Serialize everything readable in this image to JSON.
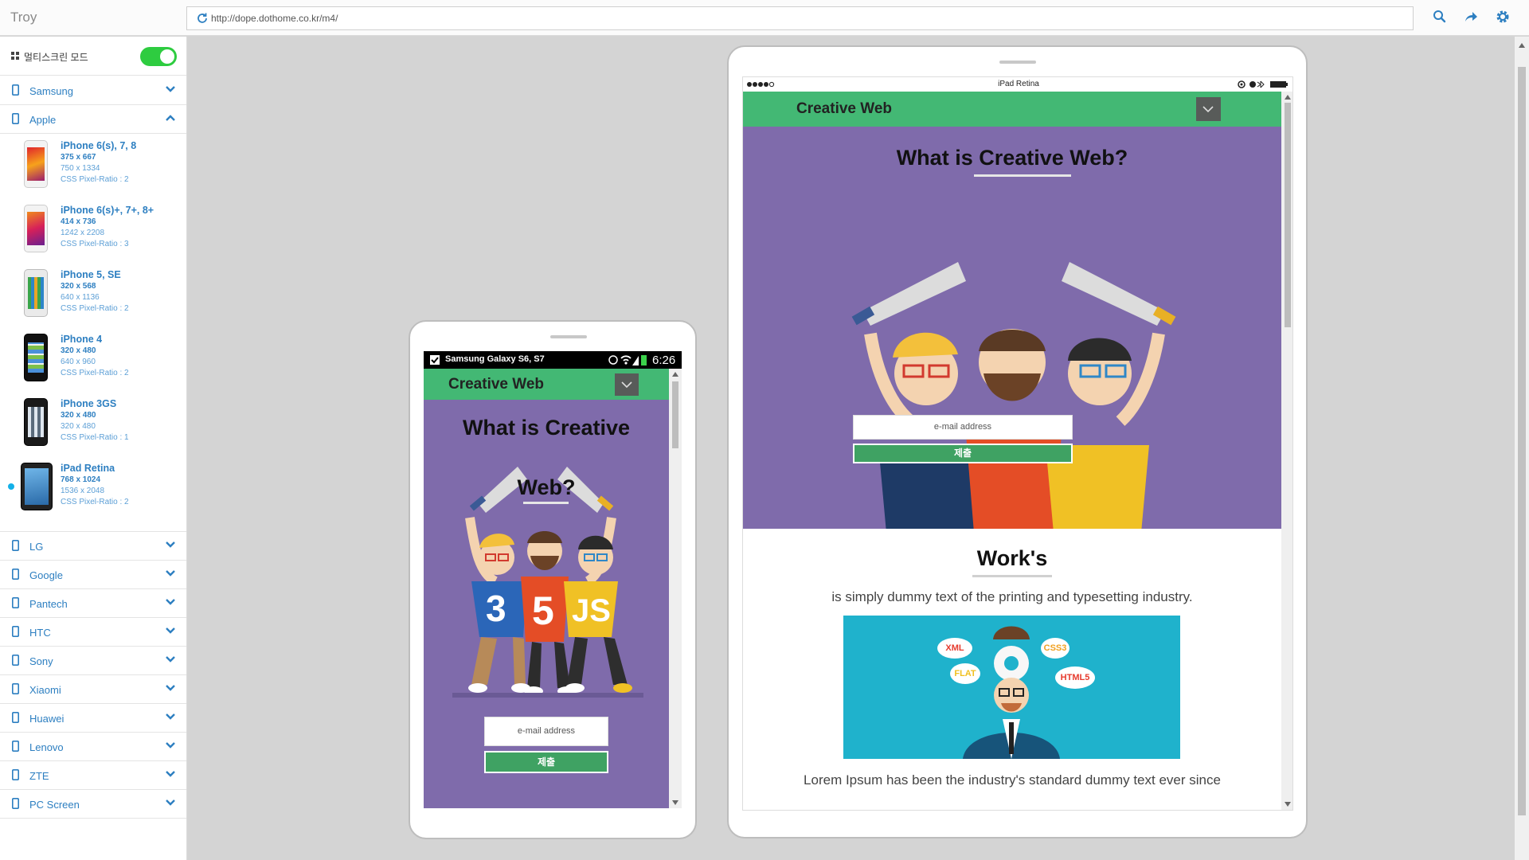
{
  "app": {
    "title": "Troy"
  },
  "address_bar": {
    "url": "http://dope.dothome.co.kr/m4/"
  },
  "sidebar": {
    "multiscreen_label": "멀티스크린 모드",
    "multiscreen_enabled": true,
    "brands_top": [
      {
        "label": "Samsung",
        "expanded": false
      },
      {
        "label": "Apple",
        "expanded": true
      }
    ],
    "apple_devices": [
      {
        "name": "iPhone 6(s), 7, 8",
        "resolution": "375 x 667",
        "physical": "750 x 1334",
        "ratio": "CSS Pixel-Ratio : 2"
      },
      {
        "name": "iPhone 6(s)+, 7+, 8+",
        "resolution": "414 x 736",
        "physical": "1242 x 2208",
        "ratio": "CSS Pixel-Ratio : 3"
      },
      {
        "name": "iPhone 5, SE",
        "resolution": "320 x 568",
        "physical": "640 x 1136",
        "ratio": "CSS Pixel-Ratio : 2"
      },
      {
        "name": "iPhone 4",
        "resolution": "320 x 480",
        "physical": "640 x 960",
        "ratio": "CSS Pixel-Ratio : 2"
      },
      {
        "name": "iPhone 3GS",
        "resolution": "320 x 480",
        "physical": "320 x 480",
        "ratio": "CSS Pixel-Ratio : 1"
      },
      {
        "name": "iPad Retina",
        "resolution": "768 x 1024",
        "physical": "1536 x 2048",
        "ratio": "CSS Pixel-Ratio : 2",
        "active": true
      }
    ],
    "brands_bottom": [
      {
        "label": "LG"
      },
      {
        "label": "Google"
      },
      {
        "label": "Pantech"
      },
      {
        "label": "HTC"
      },
      {
        "label": "Sony"
      },
      {
        "label": "Xiaomi"
      },
      {
        "label": "Huawei"
      },
      {
        "label": "Lenovo"
      },
      {
        "label": "ZTE"
      },
      {
        "label": "PC Screen"
      }
    ]
  },
  "phone": {
    "device_label": "Samsung Galaxy S6, S7",
    "time": "6:26",
    "site_title": "Creative Web",
    "headline_line1": "What is Creative",
    "headline_line2": "Web?",
    "email_placeholder": "e-mail address",
    "submit_label": "제출"
  },
  "ipad": {
    "device_label": "iPad Retina",
    "site_title": "Creative Web",
    "headline": "What is Creative Web?",
    "email_placeholder": "e-mail address",
    "submit_label": "제출",
    "works_title": "Work's",
    "works_text": "is simply dummy text of the printing and typesetting industry.",
    "lorem_text": "Lorem Ipsum has been the industry's standard dummy text ever since",
    "bubbles": [
      "XML",
      "CSS3",
      "FLAT",
      "HTML5"
    ]
  },
  "colors": {
    "brand_link": "#2d7fc1",
    "toggle_on": "#2ecc40",
    "site_green": "#43b874",
    "site_purple": "#7f6bab",
    "work_bg": "#1fb2cc"
  }
}
